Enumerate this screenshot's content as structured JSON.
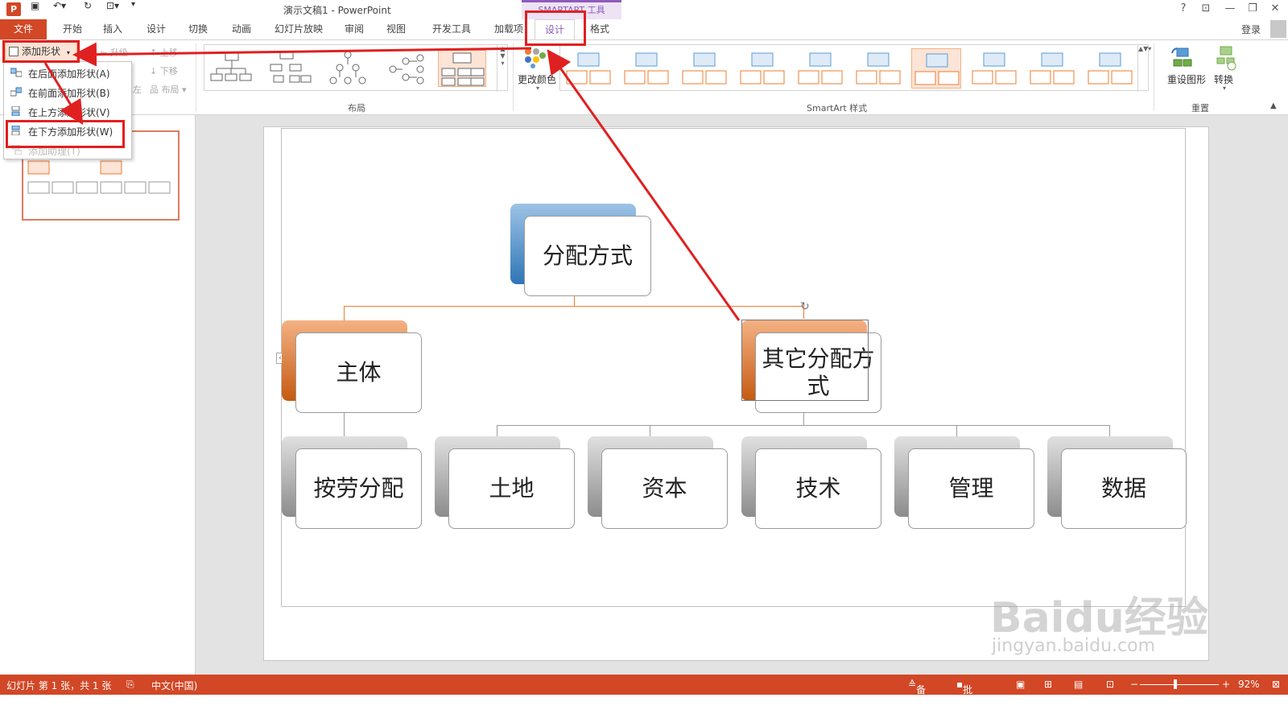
{
  "titlebar": {
    "app_icon": "P",
    "doc_title": "演示文稿1 - PowerPoint",
    "contextual_group": "SMARTART 工具",
    "help": "?",
    "minimize": "—",
    "restore": "❐",
    "close": "✕"
  },
  "tabs": {
    "file": "文件",
    "items": [
      "开始",
      "插入",
      "设计",
      "切换",
      "动画",
      "幻灯片放映",
      "审阅",
      "视图",
      "开发工具",
      "加载项"
    ],
    "smart_design": "设计",
    "smart_format": "格式",
    "login": "登录"
  },
  "ribbon": {
    "add_shape": "添加形状",
    "promote": "升级",
    "move_up": "上移",
    "move_down": "下移",
    "layout": "布局",
    "layout_group": "布局",
    "change_colors": "更改颜色",
    "styles_group": "SmartArt 样式",
    "reset_graphic": "重设图形",
    "convert": "转换",
    "reset_group": "重置",
    "left_label": "左"
  },
  "menu": {
    "items": [
      "在后面添加形状(A)",
      "在前面添加形状(B)",
      "在上方添加形状(V)",
      "在下方添加形状(W)",
      "添加助理(T)"
    ]
  },
  "diagram": {
    "root": "分配方式",
    "level1": [
      "主体",
      "其它分配方式"
    ],
    "level2": [
      "按劳分配",
      "土地",
      "资本",
      "技术",
      "管理",
      "数据"
    ]
  },
  "statusbar": {
    "slide_info": "幻灯片 第 1 张，共 1 张",
    "language": "中文(中国)",
    "notes": "备注",
    "comments": "批注",
    "zoom": "92%"
  },
  "watermark": {
    "brand": "Baidu经验",
    "url": "jingyan.baidu.com"
  },
  "colors": {
    "accent": "#d24726",
    "smartart": "#8e5aba",
    "annotation": "#e02020",
    "node_blue": "#5b9bd5",
    "node_orange": "#ed7d31",
    "node_gray": "#a5a5a5"
  }
}
